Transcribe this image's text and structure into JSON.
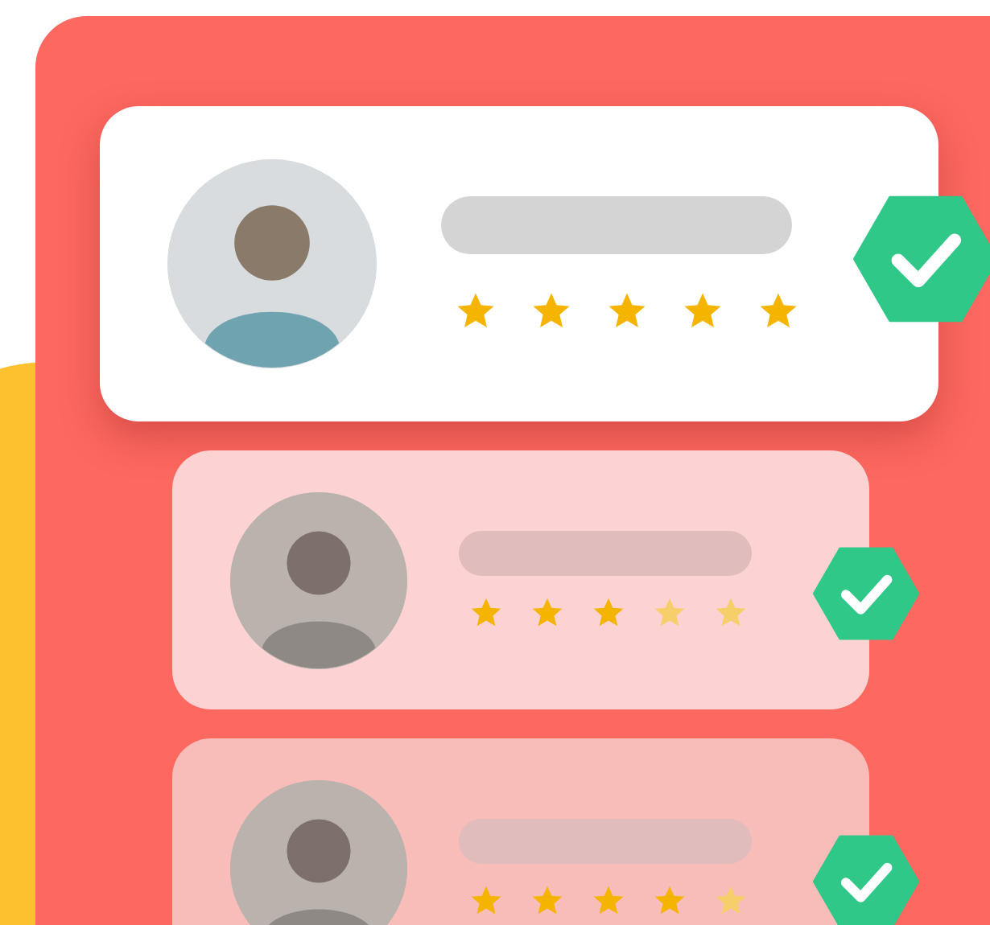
{
  "reviews": [
    {
      "selected": true,
      "stars": 5,
      "verified": true
    },
    {
      "selected": false,
      "stars": 3,
      "verified": true
    },
    {
      "selected": false,
      "stars": 4,
      "verified": true
    }
  ]
}
